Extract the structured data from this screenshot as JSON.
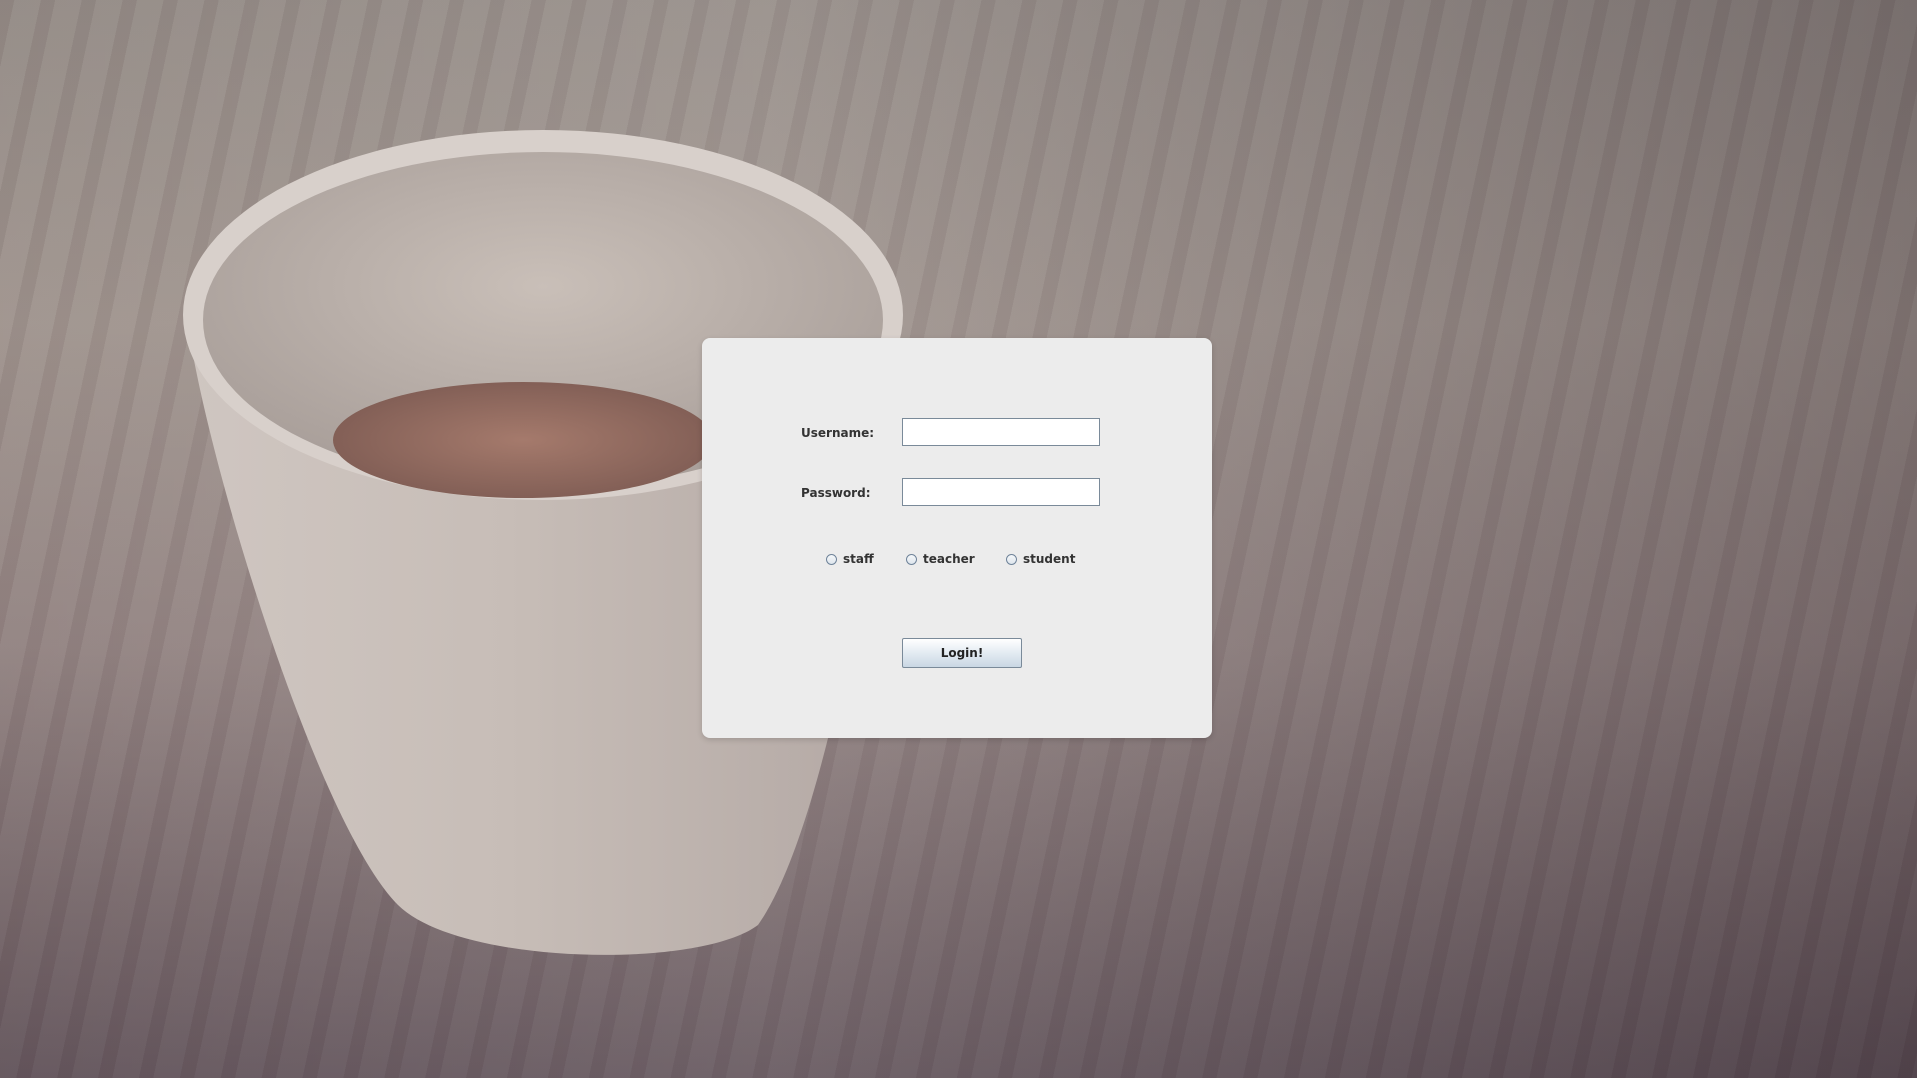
{
  "login_form": {
    "username_label": "Username:",
    "username_value": "",
    "password_label": "Password:",
    "password_value": "",
    "role_options": [
      "staff",
      "teacher",
      "student"
    ],
    "selected_role": null,
    "submit_label": "Login!"
  },
  "colors": {
    "panel_background": "#ececec",
    "input_border": "#7a8a99",
    "label_text": "#333333"
  }
}
